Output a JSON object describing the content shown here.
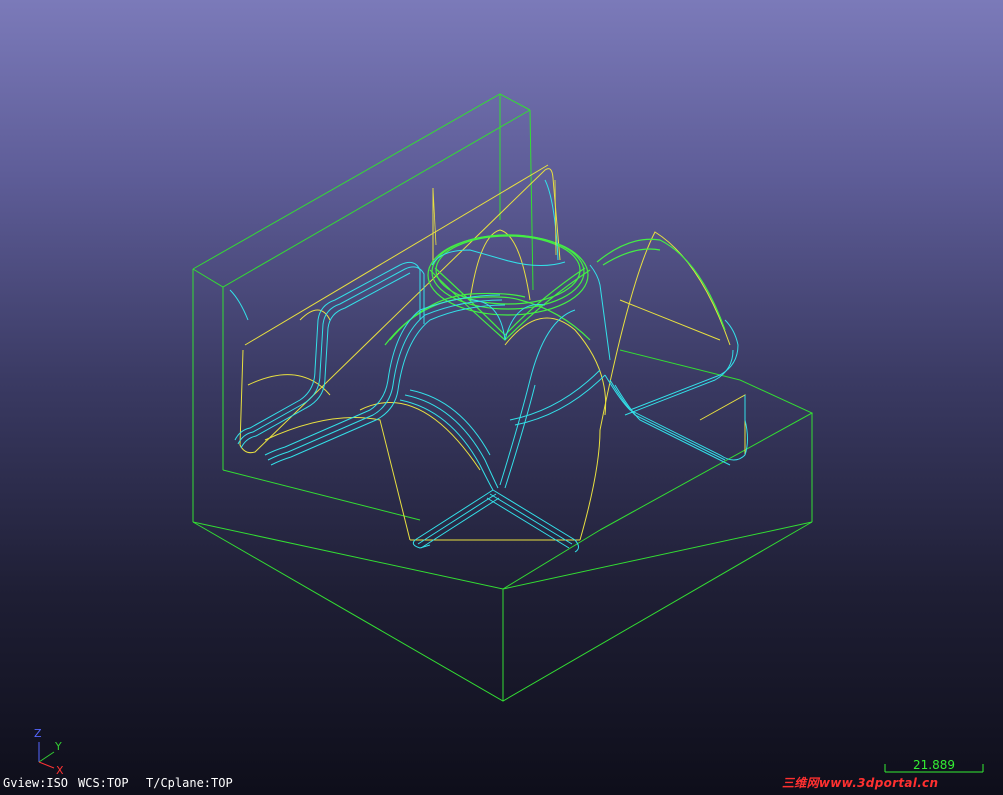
{
  "status_bar": {
    "gview": "Gview:ISO",
    "wcs": "WCS:TOP",
    "tplane": "T/Cplane:TOP"
  },
  "axis_triad": {
    "z_label": "Z",
    "y_label": "Y",
    "x_label": "X"
  },
  "scale_bar": {
    "value": "21.889"
  },
  "watermark": {
    "text": "三维网www.3dportal.cn"
  },
  "colors": {
    "background_top": "#7b7ab9",
    "background_bottom": "#0e0e1a",
    "stock_wireframe": "#33dd33",
    "toolpath_cyan": "#33e0e8",
    "toolpath_yellow": "#e8e040",
    "toolpath_green": "#44ee44",
    "status_text": "#ffffff",
    "scale_text": "#33ee33",
    "watermark": "#ff3030",
    "axis_z": "#5566ff",
    "axis_y": "#33cc33",
    "axis_x": "#ff3333"
  }
}
